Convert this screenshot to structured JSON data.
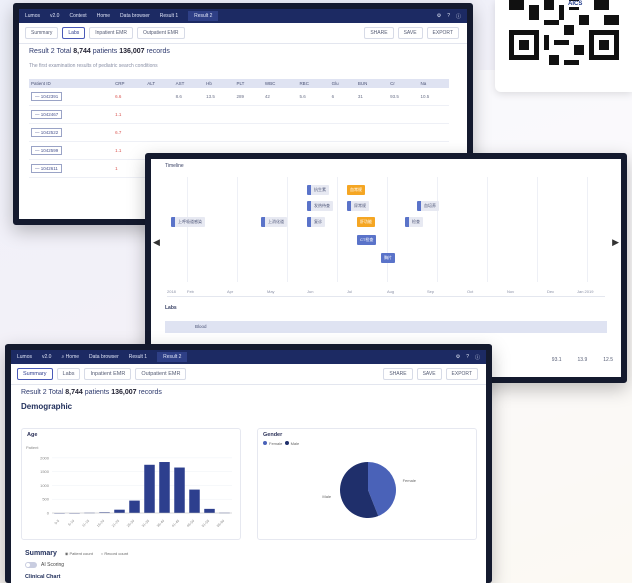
{
  "qr": {
    "brand": "AICS"
  },
  "panel_top": {
    "appbar": {
      "app": "Lumos",
      "version": "v2.0",
      "items": [
        "Context",
        "v2.0",
        "Home",
        "Data browser",
        "Result 1",
        "Result 2"
      ]
    },
    "tabs": [
      "Summary",
      "Labs",
      "Inpatient EMR",
      "Outpatient EMR"
    ],
    "actions": {
      "share": "SHARE",
      "save": "SAVE",
      "export": "EXPORT"
    },
    "result": {
      "label": "Result 2",
      "total_label": "Total",
      "patients": "8,744",
      "patients_label": "patients",
      "records": "136,007",
      "records_label": "records"
    },
    "subtitle": "The first examination results of pediatric search conditions",
    "table": {
      "headers": [
        "Patient ID",
        "CRP",
        "ALT",
        "AST",
        "Hb",
        "PLT",
        "WBC",
        "RBC",
        "Glu",
        "BUN",
        "Cr",
        "Na"
      ],
      "rows": [
        [
          "— 1042391",
          "6.6",
          "",
          "8.6",
          "13.5",
          "289",
          "42",
          "5.6",
          "6",
          "31",
          "93.5",
          "10.5"
        ],
        [
          "— 1042467",
          "1.1",
          "",
          "",
          "",
          "",
          "",
          "",
          "",
          "",
          "",
          ""
        ],
        [
          "— 1042522",
          "6.7",
          "",
          "",
          "",
          "",
          "",
          "",
          "",
          "",
          "",
          ""
        ],
        [
          "— 1042599",
          "1.1",
          "",
          "",
          "",
          "",
          "",
          "",
          "",
          "",
          "",
          ""
        ],
        [
          "— 1042611",
          "1",
          "",
          "",
          "",
          "",
          "",
          "",
          "",
          "",
          "",
          ""
        ]
      ]
    }
  },
  "panel_mid": {
    "heading": "Timeline",
    "events": [
      "上呼吸道感染",
      "上消化道",
      "抗生素",
      "发热待查",
      "血常规",
      "尿常规",
      "复诊",
      "肝功能",
      "检查",
      "CT检查",
      "胸片",
      "血培养"
    ],
    "axis": [
      "2018",
      "Feb",
      "Apr",
      "May",
      "Jun",
      "Jul",
      "Aug",
      "Sep",
      "Oct",
      "Nov",
      "Dec",
      "Jan 2019"
    ],
    "section_label": "Labs",
    "result_label": "Result",
    "table_header": "Blood",
    "values": [
      "93.1",
      "13.9",
      "12.5"
    ]
  },
  "panel_main": {
    "appbar": {
      "app": "Lumos",
      "version": "v2.0",
      "items": [
        "Home",
        "Data browser",
        "Result 1",
        "Result 2"
      ]
    },
    "tabs": [
      "Summary",
      "Labs",
      "Inpatient EMR",
      "Outpatient EMR"
    ],
    "actions": {
      "share": "SHARE",
      "save": "SAVE",
      "export": "EXPORT"
    },
    "result": {
      "label": "Result 2",
      "total_label": "Total",
      "patients": "8,744",
      "patients_label": "patients",
      "records": "136,007",
      "records_label": "records"
    },
    "section": "Demographic",
    "summary": {
      "title": "Summary",
      "opt1": "Patient count",
      "opt2": "Record count",
      "toggle": "AI Scoring",
      "clinical": "Clinical Chart"
    }
  },
  "chart_data": [
    {
      "type": "bar",
      "title": "Age",
      "ylabel": "Patient",
      "categories": [
        "0-5",
        "6-10",
        "11-15",
        "16-20",
        "21-25",
        "26-30",
        "31-35",
        "36-40",
        "41-45",
        "46-50",
        "51-55",
        "56-60"
      ],
      "values": [
        0,
        0,
        10,
        25,
        120,
        450,
        1750,
        1850,
        1650,
        850,
        150,
        10
      ],
      "ylim": [
        0,
        2250
      ],
      "yticks": [
        0,
        500,
        1000,
        1500,
        2000
      ]
    },
    {
      "type": "pie",
      "title": "Gender",
      "legend": [
        "Female",
        "Male"
      ],
      "values": [
        44,
        56
      ],
      "colors": [
        "#4a62b8",
        "#1f2f6b"
      ]
    }
  ]
}
